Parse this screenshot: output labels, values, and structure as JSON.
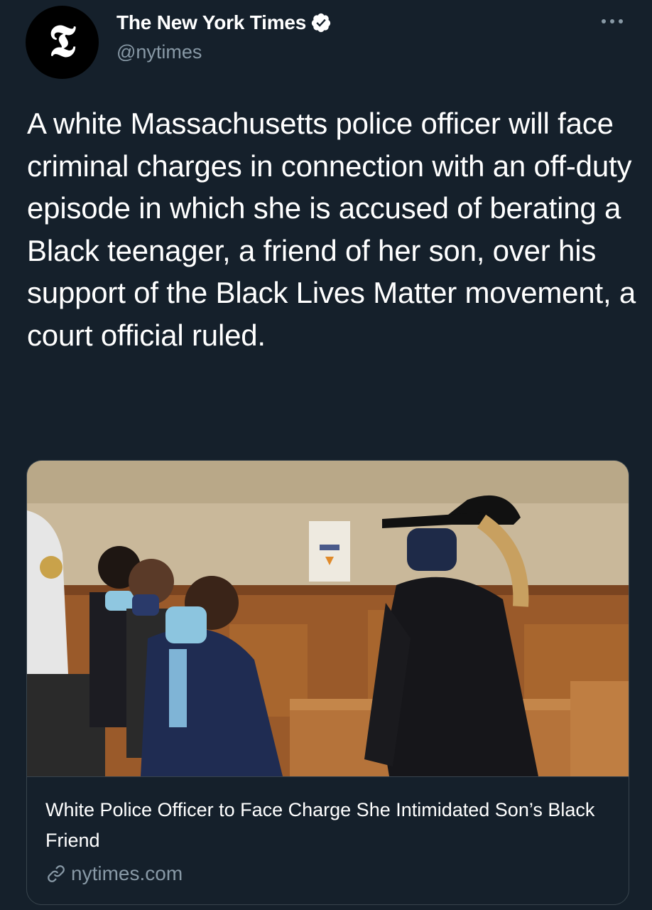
{
  "author": {
    "name": "The New York Times",
    "handle": "@nytimes",
    "avatar_glyph": "𝕿",
    "verified": true
  },
  "tweet": {
    "text": "A white Massachusetts police officer will face criminal charges in connection with an off-duty episode in which she is accused of berating a Black teenager, a friend of her son, over his support of the Black Lives Matter movement, a court official ruled."
  },
  "card": {
    "title": "White Police Officer to Face Charge She Intimidated Son’s Black Friend",
    "domain": "nytimes.com"
  },
  "colors": {
    "background": "#15202b",
    "text": "#ffffff",
    "secondary": "#8899a6",
    "border": "#38444d",
    "verified_badge": "#ffffff"
  },
  "icons": [
    "verified-badge-icon",
    "more-options-icon",
    "link-icon"
  ]
}
